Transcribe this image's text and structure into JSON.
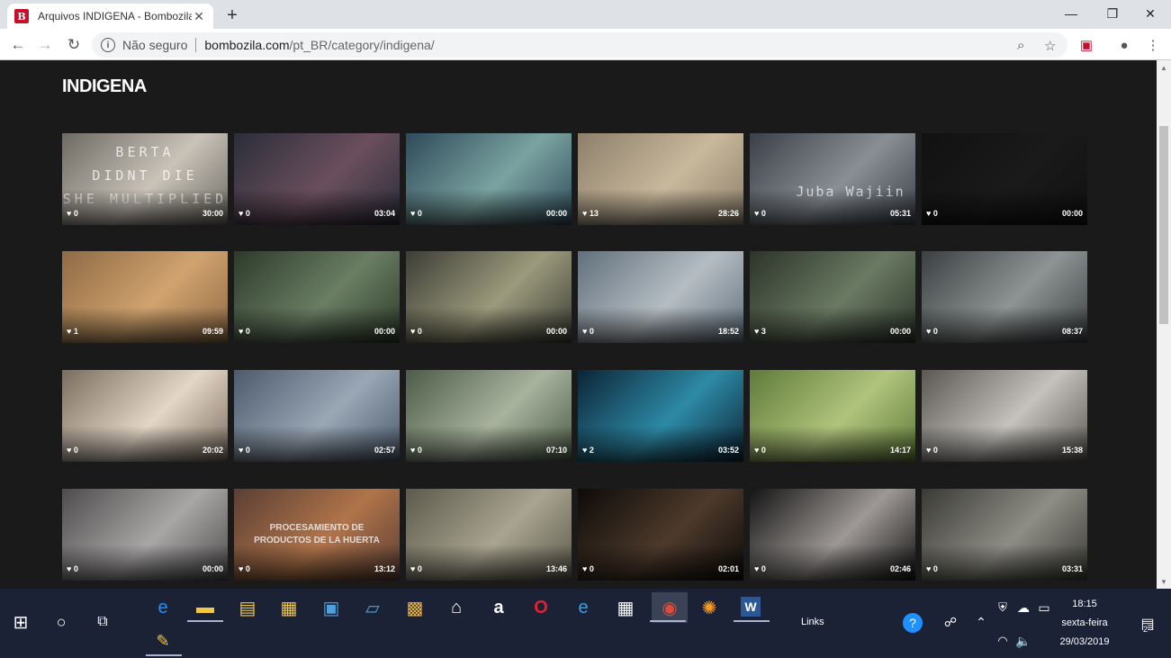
{
  "browser": {
    "tab_title": "Arquivos INDIGENA - Bombozila",
    "favicon_letter": "B",
    "security_text": "Não seguro",
    "url_domain": "bombozila.com",
    "url_path": "/pt_BR/category/indigena/"
  },
  "page": {
    "title": "INDIGENA"
  },
  "videos": [
    {
      "likes": "0",
      "duration": "30:00",
      "overlay": [
        "BERTA",
        "DIDNT DIE",
        "SHE MULTIPLIED"
      ]
    },
    {
      "likes": "0",
      "duration": "03:04"
    },
    {
      "likes": "0",
      "duration": "00:00"
    },
    {
      "likes": "13",
      "duration": "28:26"
    },
    {
      "likes": "0",
      "duration": "05:31",
      "overlay": [
        "Juba Wajiin"
      ]
    },
    {
      "likes": "0",
      "duration": "00:00"
    },
    {
      "likes": "1",
      "duration": "09:59"
    },
    {
      "likes": "0",
      "duration": "00:00"
    },
    {
      "likes": "0",
      "duration": "00:00"
    },
    {
      "likes": "0",
      "duration": "18:52"
    },
    {
      "likes": "3",
      "duration": "00:00"
    },
    {
      "likes": "0",
      "duration": "08:37"
    },
    {
      "likes": "0",
      "duration": "20:02"
    },
    {
      "likes": "0",
      "duration": "02:57"
    },
    {
      "likes": "0",
      "duration": "07:10"
    },
    {
      "likes": "2",
      "duration": "03:52"
    },
    {
      "likes": "0",
      "duration": "14:17"
    },
    {
      "likes": "0",
      "duration": "15:38"
    },
    {
      "likes": "0",
      "duration": "00:00"
    },
    {
      "likes": "0",
      "duration": "13:12",
      "overlay": [
        "PROCESAMIENTO DE",
        "PRODUCTOS DE LA HUERTA"
      ]
    },
    {
      "likes": "0",
      "duration": "13:46"
    },
    {
      "likes": "0",
      "duration": "02:01"
    },
    {
      "likes": "0",
      "duration": "02:46"
    },
    {
      "likes": "0",
      "duration": "03:31"
    }
  ],
  "thumb_colors": [
    [
      "#6d6a63",
      "#c9c3b8"
    ],
    [
      "#2b2d3a",
      "#6b4f5d"
    ],
    [
      "#2f4a5a",
      "#7aa3a0"
    ],
    [
      "#8d7f6b",
      "#c8b89c"
    ],
    [
      "#3a4048",
      "#8a8f95"
    ],
    [
      "#111111",
      "#1a1a1a"
    ],
    [
      "#8e6a45",
      "#d1a36e"
    ],
    [
      "#2d3a2a",
      "#6a7e64"
    ],
    [
      "#3c3e36",
      "#9c9a7c"
    ],
    [
      "#61707c",
      "#b5bdc3"
    ],
    [
      "#2c3429",
      "#6a7a63"
    ],
    [
      "#3b3f42",
      "#8e9493"
    ],
    [
      "#7a6d5f",
      "#e3d6c6"
    ],
    [
      "#4c5a6c",
      "#9aa7b5"
    ],
    [
      "#4c5b47",
      "#a8b39e"
    ],
    [
      "#0c2436",
      "#2d8aa6"
    ],
    [
      "#5f7a3a",
      "#b0c47c"
    ],
    [
      "#5a5753",
      "#c5c2bd"
    ],
    [
      "#4e4c4c",
      "#a9a6a6"
    ],
    [
      "#5b3f34",
      "#b0744a"
    ],
    [
      "#5c5a4c",
      "#a9a490"
    ],
    [
      "#0e0b09",
      "#4d3a2c"
    ],
    [
      "#141414",
      "#9d9895"
    ],
    [
      "#3a3a35",
      "#8e8d85"
    ]
  ],
  "taskbar": {
    "links_label": "Links",
    "time": "18:15",
    "day": "sexta-feira",
    "date": "29/03/2019",
    "notification_count": "2"
  }
}
